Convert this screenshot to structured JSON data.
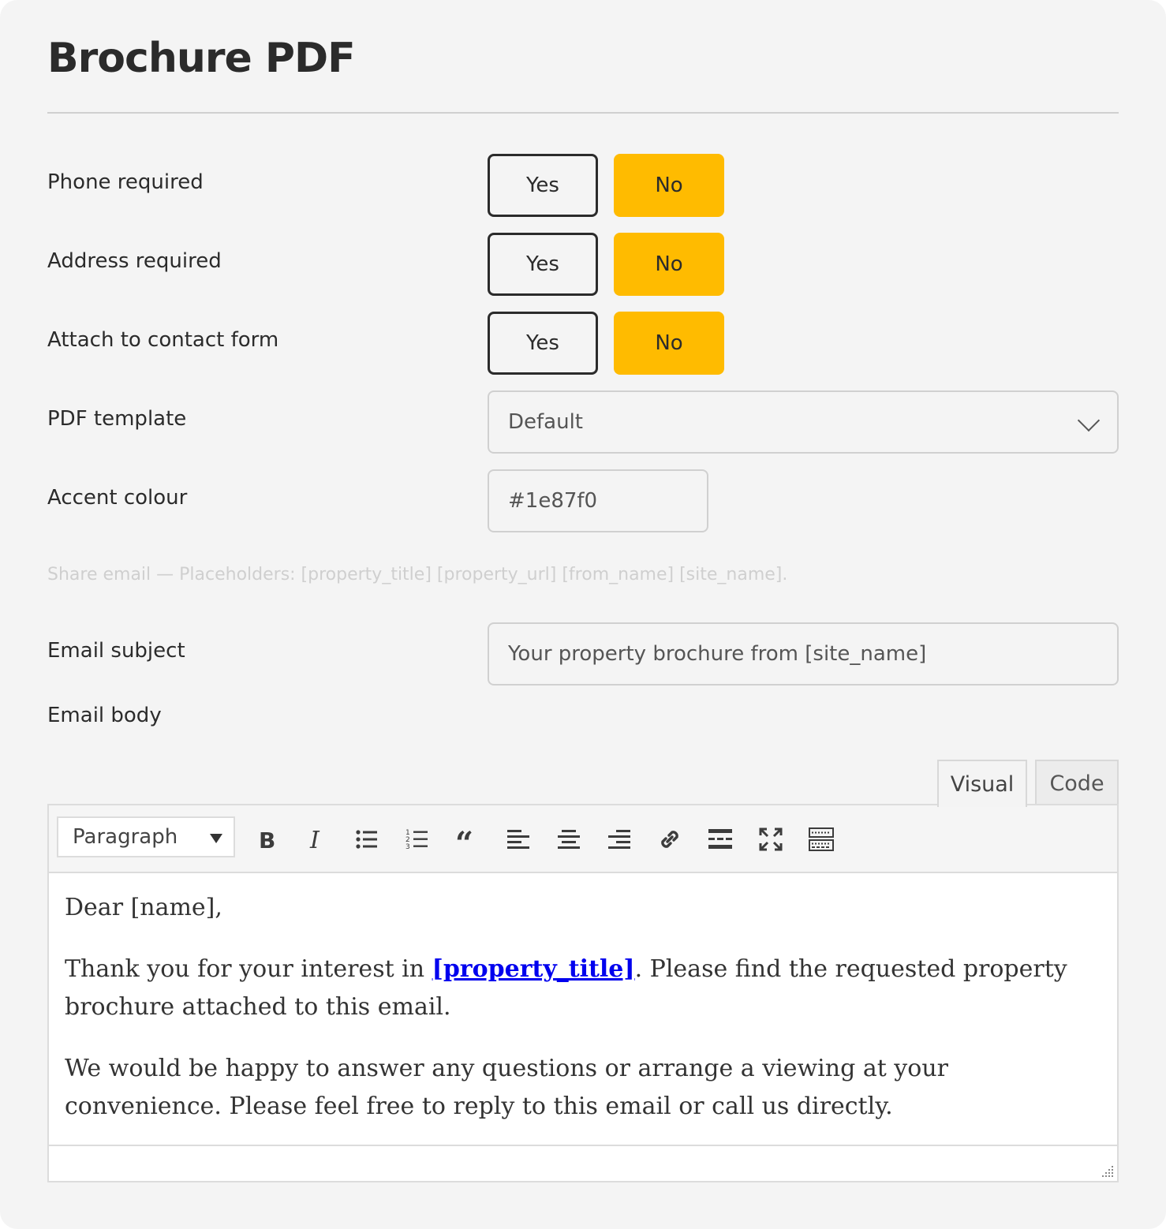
{
  "page": {
    "title": "Brochure PDF"
  },
  "settings": {
    "phone_required": {
      "label": "Phone required",
      "yes": "Yes",
      "no": "No",
      "selected": "No"
    },
    "address_required": {
      "label": "Address required",
      "yes": "Yes",
      "no": "No",
      "selected": "No"
    },
    "attach_contact": {
      "label": "Attach to contact form",
      "yes": "Yes",
      "no": "No",
      "selected": "No"
    },
    "pdf_template": {
      "label": "PDF template",
      "value": "Default"
    },
    "accent_colour": {
      "label": "Accent colour",
      "value": "#1e87f0"
    }
  },
  "hint": "Share email — Placeholders: [property_title] [property_url] [from_name] [site_name].",
  "email": {
    "subject_label": "Email subject",
    "subject_value": "Your property brochure from [site_name]",
    "body_label": "Email body"
  },
  "editor": {
    "tabs": {
      "visual": "Visual",
      "code": "Code"
    },
    "active_tab": "Visual",
    "format": "Paragraph",
    "toolbar_icons": [
      "bold-icon",
      "italic-icon",
      "bullet-list-icon",
      "numbered-list-icon",
      "blockquote-icon",
      "align-left-icon",
      "align-center-icon",
      "align-right-icon",
      "link-icon",
      "read-more-icon",
      "fullscreen-icon",
      "toolbar-toggle-icon"
    ],
    "content": {
      "p1": "Dear [name],",
      "p2_before": "Thank you for your interest in ",
      "p2_link": "[property_title]",
      "p2_after": ". Please find the requested property brochure attached to this email.",
      "p3": "We would be happy to answer any questions or arrange a viewing at your convenience. Please feel free to reply to this email or call us directly."
    }
  },
  "colors": {
    "accent": "#ffbb00",
    "link": "#0000ee",
    "panel": "#f4f4f4"
  }
}
